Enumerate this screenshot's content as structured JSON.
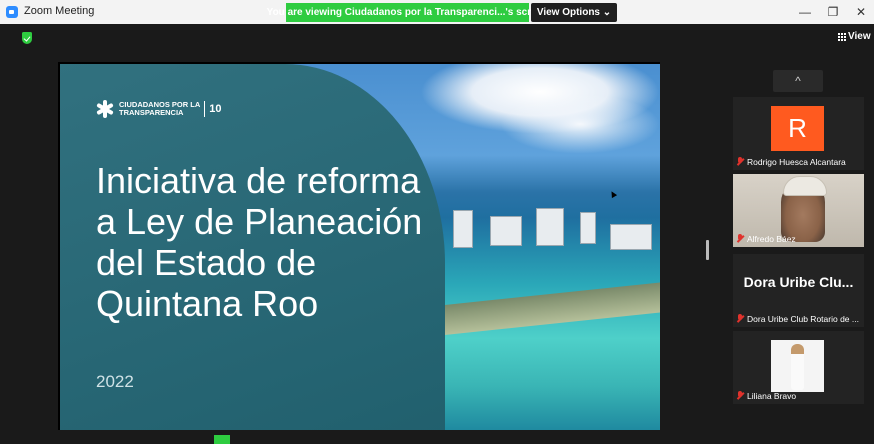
{
  "window": {
    "title": "Zoom Meeting",
    "share_banner": "You are viewing Ciudadanos por la Transparenci...'s screen",
    "view_options": "View Options ⌄",
    "minimize": "—",
    "restore": "❐",
    "close": "✕"
  },
  "toolbar": {
    "view_label": "View"
  },
  "slide": {
    "logo_line1": "CIUDADANOS POR LA",
    "logo_line2": "TRANSPARENCIA",
    "logo_badge": "10",
    "title": "Iniciativa de reforma a Ley de Planeación del Estado de Quintana Roo",
    "year": "2022"
  },
  "gallery": {
    "scroll_up": "^",
    "participants": [
      {
        "name": "Rodrigo Huesca Alcantara",
        "avatar_letter": "R",
        "muted": true,
        "avatar_color": "#ff5a1f"
      },
      {
        "name": "Alfredo Báez",
        "muted": true
      },
      {
        "name": "Dora Uribe Club Rotario de ...",
        "display_name": "Dora Uribe Clu...",
        "muted": true
      },
      {
        "name": "Liliana Bravo",
        "muted": true
      }
    ]
  },
  "colors": {
    "accent_green": "#2ecc40",
    "slide_panel": "#246877",
    "muted_red": "#e0322c"
  }
}
